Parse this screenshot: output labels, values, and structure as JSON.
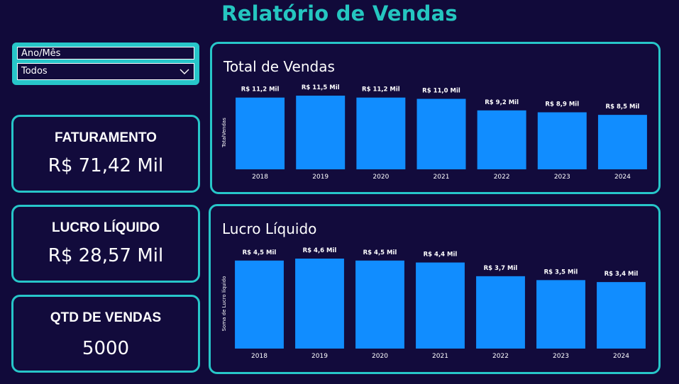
{
  "page": {
    "title": "Relatório de Vendas"
  },
  "slicer": {
    "label": "Ano/Mês",
    "selected": "Todos"
  },
  "kpis": {
    "faturamento": {
      "title": "FATURAMENTO",
      "value": "R$ 71,42 Mil"
    },
    "lucro": {
      "title": "LUCRO LÍQUIDO",
      "value": "R$ 28,57 Mil"
    },
    "qtd": {
      "title": "QTD DE VENDAS",
      "value": "5000"
    }
  },
  "colors": {
    "accent": "#27c6c9",
    "title": "#25c6c0",
    "bar": "#118dff",
    "background": "#110a3a"
  },
  "chart_data": [
    {
      "type": "bar",
      "title": "Total de Vendas",
      "ylabel": "TotalVendas",
      "xlabel": "",
      "categories": [
        "2018",
        "2019",
        "2020",
        "2021",
        "2022",
        "2023",
        "2024"
      ],
      "values": [
        11.2,
        11.5,
        11.2,
        11.0,
        9.2,
        8.9,
        8.5
      ],
      "labels": [
        "R$ 11,2 Mil",
        "R$ 11,5 Mil",
        "R$ 11,2 Mil",
        "R$ 11,0 Mil",
        "R$ 9,2 Mil",
        "R$ 8,9 Mil",
        "R$ 8,5 Mil"
      ],
      "ylim": [
        0,
        11.5
      ],
      "grid": false
    },
    {
      "type": "bar",
      "title": "Lucro Líquido",
      "ylabel": "Soma de Lucro líquido",
      "xlabel": "",
      "categories": [
        "2018",
        "2019",
        "2020",
        "2021",
        "2022",
        "2023",
        "2024"
      ],
      "values": [
        4.5,
        4.6,
        4.5,
        4.4,
        3.7,
        3.5,
        3.4
      ],
      "labels": [
        "R$ 4,5 Mil",
        "R$ 4,6 Mil",
        "R$ 4,5 Mil",
        "R$ 4,4 Mil",
        "R$ 3,7 Mil",
        "R$ 3,5 Mil",
        "R$ 3,4 Mil"
      ],
      "ylim": [
        0,
        4.6
      ],
      "grid": false
    }
  ]
}
